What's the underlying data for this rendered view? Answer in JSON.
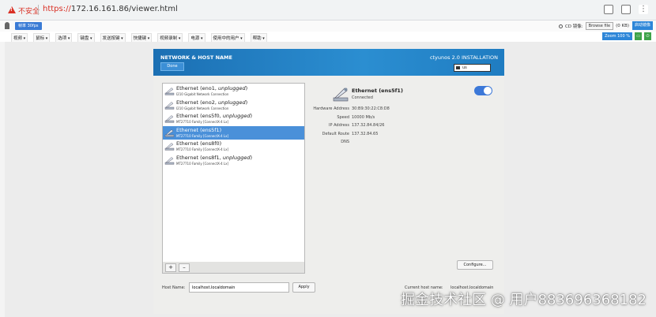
{
  "browser": {
    "security_label": "不安全",
    "url_scheme": "https://",
    "url_rest": "172.16.161.86/viewer.html"
  },
  "kvm_bar": {
    "badge": "帧率 30fps",
    "cd_label": "CD 镜像:",
    "cd_button": "Browse file",
    "cd_size": "(0 KB)",
    "start_button": "启动镜像",
    "menus": [
      "视频",
      "鼠标",
      "选项",
      "键盘",
      "发送按键",
      "快捷键",
      "视频录制",
      "电源",
      "使用中的用户",
      "帮助"
    ],
    "zoom": "Zoom 100 %",
    "color_accent": "#2d86d8"
  },
  "installer": {
    "header_title": "NETWORK & HOST NAME",
    "done_label": "Done",
    "product_title": "ctyunos 2.0 INSTALLATION",
    "keyboard_layout": "us",
    "banner_color": "#1b6fb3",
    "devices": [
      {
        "name": "Ethernet (eno1, ",
        "state": "unplugged",
        "suffix": ")",
        "desc": "I210 Gigabit Network Connection",
        "selected": false
      },
      {
        "name": "Ethernet (eno2, ",
        "state": "unplugged",
        "suffix": ")",
        "desc": "I210 Gigabit Network Connection",
        "selected": false
      },
      {
        "name": "Ethernet (ens5f0, ",
        "state": "unplugged",
        "suffix": ")",
        "desc": "MT27710 Family [ConnectX-4 Lx]",
        "selected": false
      },
      {
        "name": "Ethernet (ens5f1)",
        "state": "",
        "suffix": "",
        "desc": "MT27710 Family [ConnectX-4 Lx]",
        "selected": true
      },
      {
        "name": "Ethernet (ens8f0)",
        "state": "",
        "suffix": "",
        "desc": "MT27710 Family [ConnectX-4 Lx]",
        "selected": false
      },
      {
        "name": "Ethernet (ens8f1, ",
        "state": "unplugged",
        "suffix": ")",
        "desc": "MT27710 Family [ConnectX-4 Lx]",
        "selected": false
      }
    ],
    "add_label": "+",
    "remove_label": "–",
    "detail": {
      "name": "Ethernet (ens5f1)",
      "status": "Connected",
      "props": [
        {
          "label": "Hardware Address",
          "value": "30:B9:30:22:C8:D8"
        },
        {
          "label": "Speed",
          "value": "10000 Mb/s"
        },
        {
          "label": "IP Address",
          "value": "137.32.84.84/26"
        },
        {
          "label": "Default Route",
          "value": "137.32.84.65"
        },
        {
          "label": "DNS",
          "value": ""
        }
      ],
      "toggle_on": true
    },
    "configure_label": "Configure...",
    "host_label": "Host Name:",
    "host_value": "localhost.localdomain",
    "apply_label": "Apply",
    "current_host_label": "Current host name:",
    "current_host_value": "localhost.localdomain"
  },
  "watermark": "掘金技术社区 @ 用户883696368182"
}
